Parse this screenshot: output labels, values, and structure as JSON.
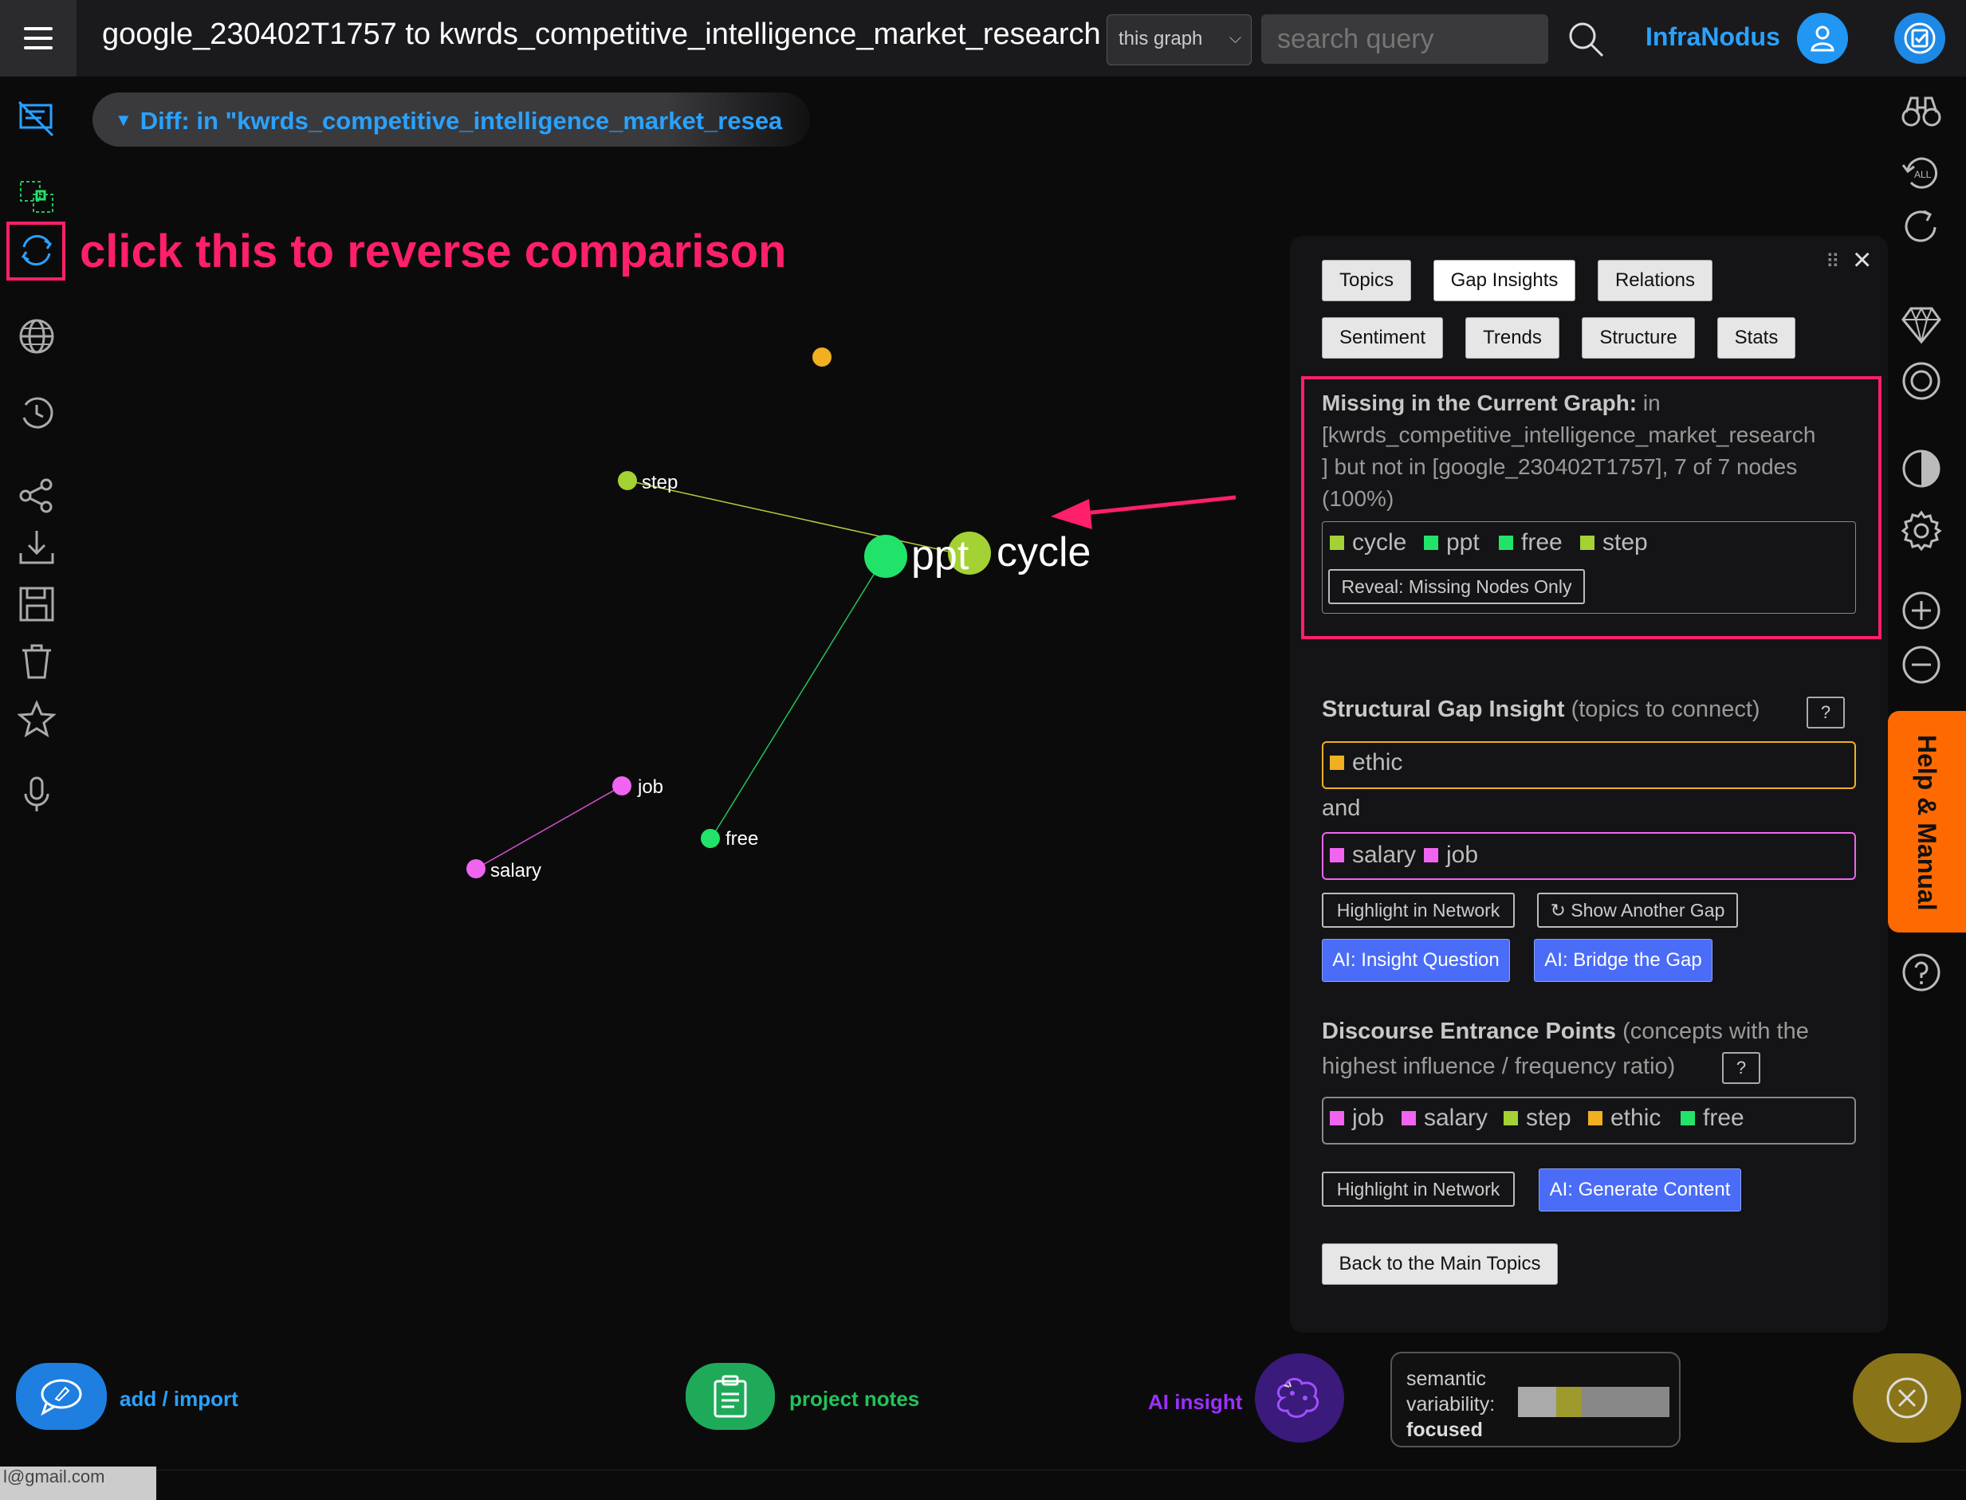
{
  "header": {
    "title": "google_230402T1757 to kwrds_competitive_intelligence_market_research",
    "graph_select": "this graph",
    "search_placeholder": "search query",
    "brand": "InfraNodus"
  },
  "diff_label": "Diff: in \"kwrds_competitive_intelligence_market_resea",
  "annotation": "click this to reverse comparison",
  "graph_nodes": [
    {
      "label": "step",
      "color": "#a4d133"
    },
    {
      "label": "ppt",
      "color": "#22e36a"
    },
    {
      "label": "cycle",
      "color": "#a4d133"
    },
    {
      "label": "job",
      "color": "#f064f0"
    },
    {
      "label": "salary",
      "color": "#f064f0"
    },
    {
      "label": "free",
      "color": "#22e36a"
    }
  ],
  "panel": {
    "tabs": [
      "Topics",
      "Gap Insights",
      "Relations",
      "Sentiment",
      "Trends",
      "Structure",
      "Stats"
    ],
    "missing": {
      "heading": "Missing in the Current Graph:",
      "body_1": "in",
      "body_2": "[kwrds_competitive_intelligence_market_research",
      "body_3": "] but not in [google_230402T1757], 7 of 7 nodes",
      "body_4": "(100%)",
      "nodes": [
        "cycle",
        "ppt",
        "free",
        "step"
      ],
      "reveal_button": "Reveal: Missing Nodes Only"
    },
    "structural_gap": {
      "heading": "Structural Gap Insight",
      "subheading": "(topics to connect)",
      "help": "?",
      "topic_a": [
        "ethic"
      ],
      "and": "and",
      "topic_b": [
        "salary",
        "job"
      ],
      "highlight_button": "Highlight in Network",
      "another_gap_button": "↻ Show Another Gap",
      "ai_question_button": "AI: Insight Question",
      "ai_bridge_button": "AI: Bridge the Gap"
    },
    "entrance_points": {
      "heading": "Discourse Entrance Points",
      "subheading_1": "(concepts with the",
      "subheading_2": "highest influence / frequency ratio)",
      "help": "?",
      "nodes": [
        "job",
        "salary",
        "step",
        "ethic",
        "free"
      ],
      "highlight_button": "Highlight in Network",
      "ai_generate_button": "AI: Generate Content"
    },
    "back_button": "Back to the Main Topics"
  },
  "help_tab": "Help & Manual",
  "bottom": {
    "add_import": "add / import",
    "project_notes": "project notes",
    "ai_insight": "AI insight",
    "variability_1": "semantic",
    "variability_2": "variability:",
    "variability_3": "focused",
    "email": "l@gmail.com"
  },
  "colors": {
    "accent_blue": "#2aa2ff",
    "annotation_pink": "#ff1f6b",
    "green": "#22e36a",
    "lime": "#a4d133",
    "magenta": "#f064f0",
    "orange": "#f0b020"
  }
}
